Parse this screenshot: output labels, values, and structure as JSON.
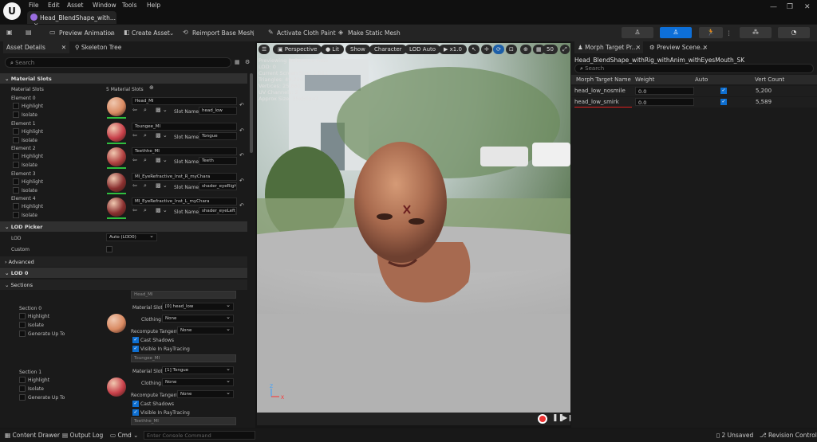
{
  "menu": [
    "File",
    "Edit",
    "Asset",
    "Window",
    "Tools",
    "Help"
  ],
  "document_tab": "Head_BlendShape_with...",
  "toolbar": {
    "preview_animation": "Preview Animation",
    "create_asset": "Create Asset",
    "reimport": "Reimport Base Mesh",
    "activate_cloth": "Activate Cloth Paint",
    "make_static": "Make Static Mesh"
  },
  "left_panel": {
    "tabs": [
      "Asset Details",
      "Skeleton Tree"
    ],
    "search_placeholder": "Search",
    "material_slots_header": "Material Slots",
    "material_slots_label": "Material Slots",
    "material_slots_count": "5 Material Slots",
    "highlight": "Highlight",
    "isolate": "Isolate",
    "slot_name_label": "Slot Name",
    "elements": [
      {
        "label": "Element 0",
        "material": "Head_MI",
        "slot": "head_low",
        "color": "#d98a62"
      },
      {
        "label": "Element 1",
        "material": "Toungee_MI",
        "slot": "Tongue",
        "color": "#c8404a"
      },
      {
        "label": "Element 2",
        "material": "Teethhe_MI",
        "slot": "Teeth",
        "color": "#b04040"
      },
      {
        "label": "Element 3",
        "material": "MI_EyeRefractive_Inst_R_myChara",
        "slot": "shader_eyeRight_",
        "color": "#8a3030"
      },
      {
        "label": "Element 4",
        "material": "MI_EyeRefractive_Inst_L_myChara",
        "slot": "shader_eyeLeft_sl",
        "color": "#8a3030"
      }
    ],
    "lod_picker_header": "LOD Picker",
    "lod_label": "LOD",
    "lod_value": "Auto (LOD0)",
    "custom_label": "Custom",
    "advanced_label": "Advanced",
    "lod0_header": "LOD 0",
    "sections_label": "Sections",
    "sections": [
      {
        "label": "Section 0",
        "material_ghost": "Head_MI",
        "material_slot": "[0] head_low",
        "clothing": "None",
        "recompute": "None",
        "color": "#d98a62"
      },
      {
        "label": "Section 1",
        "material_ghost": "Toungee_MI",
        "material_slot": "[1] Tongue",
        "clothing": "None",
        "recompute": "None",
        "color": "#c8404a"
      }
    ],
    "generate_up_to": "Generate Up To",
    "material_slot_label": "Material Slot",
    "clothing_label": "Clothing",
    "recompute_label": "Recompute Tangents",
    "cast_shadows": "Cast Shadows",
    "visible_raytracing": "Visible In RayTracing",
    "trailing_ghost": "Teethhe_MI"
  },
  "viewport": {
    "perspective": "Perspective",
    "lit": "Lit",
    "show": "Show",
    "character": "Character",
    "lod_auto": "LOD Auto",
    "speed": "x1.0",
    "fov": "50",
    "info": [
      "Previewing Reference Pose",
      "LOD: 0",
      "Current Screen Size: 1.011",
      "Triangles: 49,204",
      "Vertices: 25,861",
      "UV Channels: 2",
      "Approx Size: 35x50x47"
    ]
  },
  "right_panel": {
    "tabs": [
      "Morph Target Pr...",
      "Preview Scene..."
    ],
    "asset_name": "Head_BlendShape_withRig_withAnim_withEyesMouth_SK",
    "search_placeholder": "Search",
    "columns": [
      "Morph Target Name",
      "Weight",
      "Auto",
      "Vert Count"
    ],
    "rows": [
      {
        "name": "head_low_nosmile",
        "weight": "0.0",
        "vert_count": "5,200"
      },
      {
        "name": "head_low_smirk",
        "weight": "0.0",
        "vert_count": "5,589"
      }
    ]
  },
  "statusbar": {
    "content_drawer": "Content Drawer",
    "output_log": "Output Log",
    "cmd": "Cmd",
    "console_placeholder": "Enter Console Command",
    "unsaved": "2 Unsaved",
    "revision": "Revision Control"
  }
}
